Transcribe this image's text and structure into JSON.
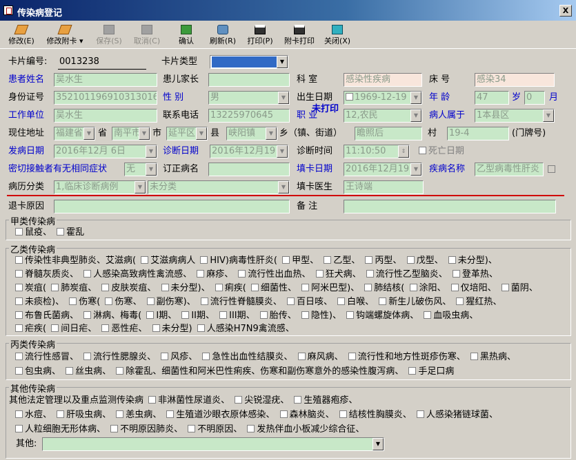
{
  "window": {
    "title": "传染病登记",
    "close_glyph": "X"
  },
  "toolbar": {
    "items": [
      {
        "label": "修改(E)",
        "icon": "edit-card-icon",
        "enabled": true
      },
      {
        "label": "修改附卡",
        "icon": "edit-attach-icon",
        "enabled": true
      },
      {
        "label": "保存(S)",
        "icon": "save-icon",
        "enabled": false
      },
      {
        "label": "取消(C)",
        "icon": "cancel-icon",
        "enabled": false
      },
      {
        "label": "确认",
        "icon": "confirm-icon",
        "enabled": true
      },
      {
        "label": "刷新(R)",
        "icon": "refresh-icon",
        "enabled": true
      },
      {
        "label": "打印(P)",
        "icon": "printer-icon",
        "enabled": true
      },
      {
        "label": "附卡打印",
        "icon": "printer-icon",
        "enabled": true
      },
      {
        "label": "关闭(X)",
        "icon": "close-icon",
        "enabled": true
      }
    ]
  },
  "form": {
    "card_no_label": "卡片编号:",
    "card_no": "0013238",
    "card_type_label": "卡片类型",
    "card_type": "",
    "print_status": "未打印",
    "patient_name_label": "患者姓名",
    "patient_name": "吴水生",
    "guardian_label": "患儿家长",
    "guardian": "",
    "dept_label": "科   室",
    "dept": "感染性疾病",
    "bed_label": "床   号",
    "bed": "感染34",
    "id_label": "身份证号",
    "id_no": "352101196910313016",
    "sex_label": "性   别",
    "sex": "男",
    "birth_label": "出生日期",
    "birth": "1969-12-19",
    "age_label": "年   龄",
    "age": "47",
    "age_unit": "岁",
    "month": "0",
    "month_unit": "月",
    "work_label": "工作单位",
    "work": "吴水生",
    "phone_label": "联系电话",
    "phone": "13225970645",
    "job_label": "职   业",
    "job": "12,农民",
    "belong_label": "病人属于",
    "belong": "1本县区",
    "addr_label": "现住地址",
    "province": "福建省",
    "province_unit": "省",
    "city": "南平市",
    "city_unit": "市",
    "district": "延平区",
    "district_unit": "县",
    "town": "峡阳镇",
    "town_unit": "乡（镇、街道）",
    "village": "瞻照后",
    "village_unit": "村",
    "house": "19-4",
    "house_unit": "(门牌号)",
    "onset_label": "发病日期",
    "onset": "2016年12月 6日",
    "diag_label": "诊断日期",
    "diag": "2016年12月19",
    "diag_time_label": "诊断时间",
    "diag_time": "11:10:50",
    "death_label": "死亡日期",
    "contact_label": "密切接触者有无相同症状",
    "contact": "无",
    "revise_label": "订正病名",
    "revise": "",
    "fill_date_label": "填卡日期",
    "fill_date": "2016年12月19",
    "disease_label": "疾病名称",
    "disease": "乙型病毒性肝炎",
    "case_class_label": "病历分类",
    "case_class": "1,临床诊断病例",
    "sub_class": "未分类",
    "doctor_label": "填卡医生",
    "doctor": "王诗端",
    "withdraw_label": "退卡原因",
    "withdraw": "",
    "note_label": "备   注",
    "note": ""
  },
  "groups": {
    "a_title": "甲类传染病",
    "a": [
      "鼠疫、",
      "霍乱"
    ],
    "b_title": "乙类传染病",
    "b_lines": [
      "传染性非典型肺炎、艾滋病( ☐ 艾滋病病人 ☐ HIV)病毒性肝炎( ☐ 甲型、 ☐ 乙型、 ☐ 丙型、 ☐ 戊型、 ☐ 未分型)、",
      "☐ 脊髓灰质炎、 ☐ 人感染高致病性禽流感、 ☐ 麻疹、 ☐ 流行性出血热、 ☐ 狂犬病、 ☐ 流行性乙型脑炎、 ☐ 登革热、",
      "☐ 炭疽( ☐ 肺炭疽、 ☐ 皮肤炭疽、 ☐ 未分型)、 ☐ 痢疾( ☐ 细菌性、 ☐ 阿米巴型)、 ☐ 肺结核( ☐ 涂阳、 ☐ 仅培阳、 ☐ 菌阴、",
      "☐ 未痰检)、 ☐ 伤寒( ☐ 伤寒、 ☐ 副伤寒)、 ☐ 流行性脊髓膜炎、 ☐ 百日咳、 ☐ 白喉、 ☐ 新生儿破伤风、 ☐ 猩红热、",
      "☐ 布鲁氏菌病、 ☐ 淋病、梅毒( ☐ I期、 ☐ II期、 ☐ III期、 ☐ 胎传、 ☐ 隐性)、 ☐ 钩端螺旋体病、 ☐ 血吸虫病、",
      "☐ 疟疾( ☐ 间日疟、 ☐ 恶性疟、 ☐ 未分型) ☐ 人感染H7N9禽流感、"
    ],
    "c_title": "丙类传染病",
    "c_lines": [
      "☐ 流行性感冒、 ☐ 流行性腮腺炎、 ☐ 风疹、 ☐ 急性出血性结膜炎、 ☐ 麻风病、 ☐ 流行性和地方性斑疹伤寒、 ☐ 黑热病、",
      "☐ 包虫病、 ☐ 丝虫病、 ☐ 除霍乱、细菌性和阿米巴性痢疾、伤寒和副伤寒意外的感染性腹泻病、 ☐ 手足口病"
    ],
    "d_title": "其他传染病",
    "d_lines": [
      "其他法定管理以及重点监测传染病 ☐ 非淋菌性尿道炎、 ☐ 尖锐湿疣、 ☐ 生殖器疱疹、",
      "☐ 水痘、 ☐ 肝吸虫病、 ☐ 恙虫病、 ☐ 生殖道沙眼衣原体感染、 ☐ 森林脑炎、 ☐ 结核性胸膜炎、 ☐ 人感染猪链球菌、",
      "☐ 人粒细胞无形体病、 ☐ 不明原因肺炎、 ☐ 不明原因、 ☐ 发热伴血小板减少综合征、"
    ],
    "other_label": "其他:",
    "other": ""
  },
  "colors": {
    "field_bg": "#c8e8c8",
    "pink_bg": "#f8e6dc",
    "label_blue": "#0000cc",
    "red_line": "#d00000"
  }
}
